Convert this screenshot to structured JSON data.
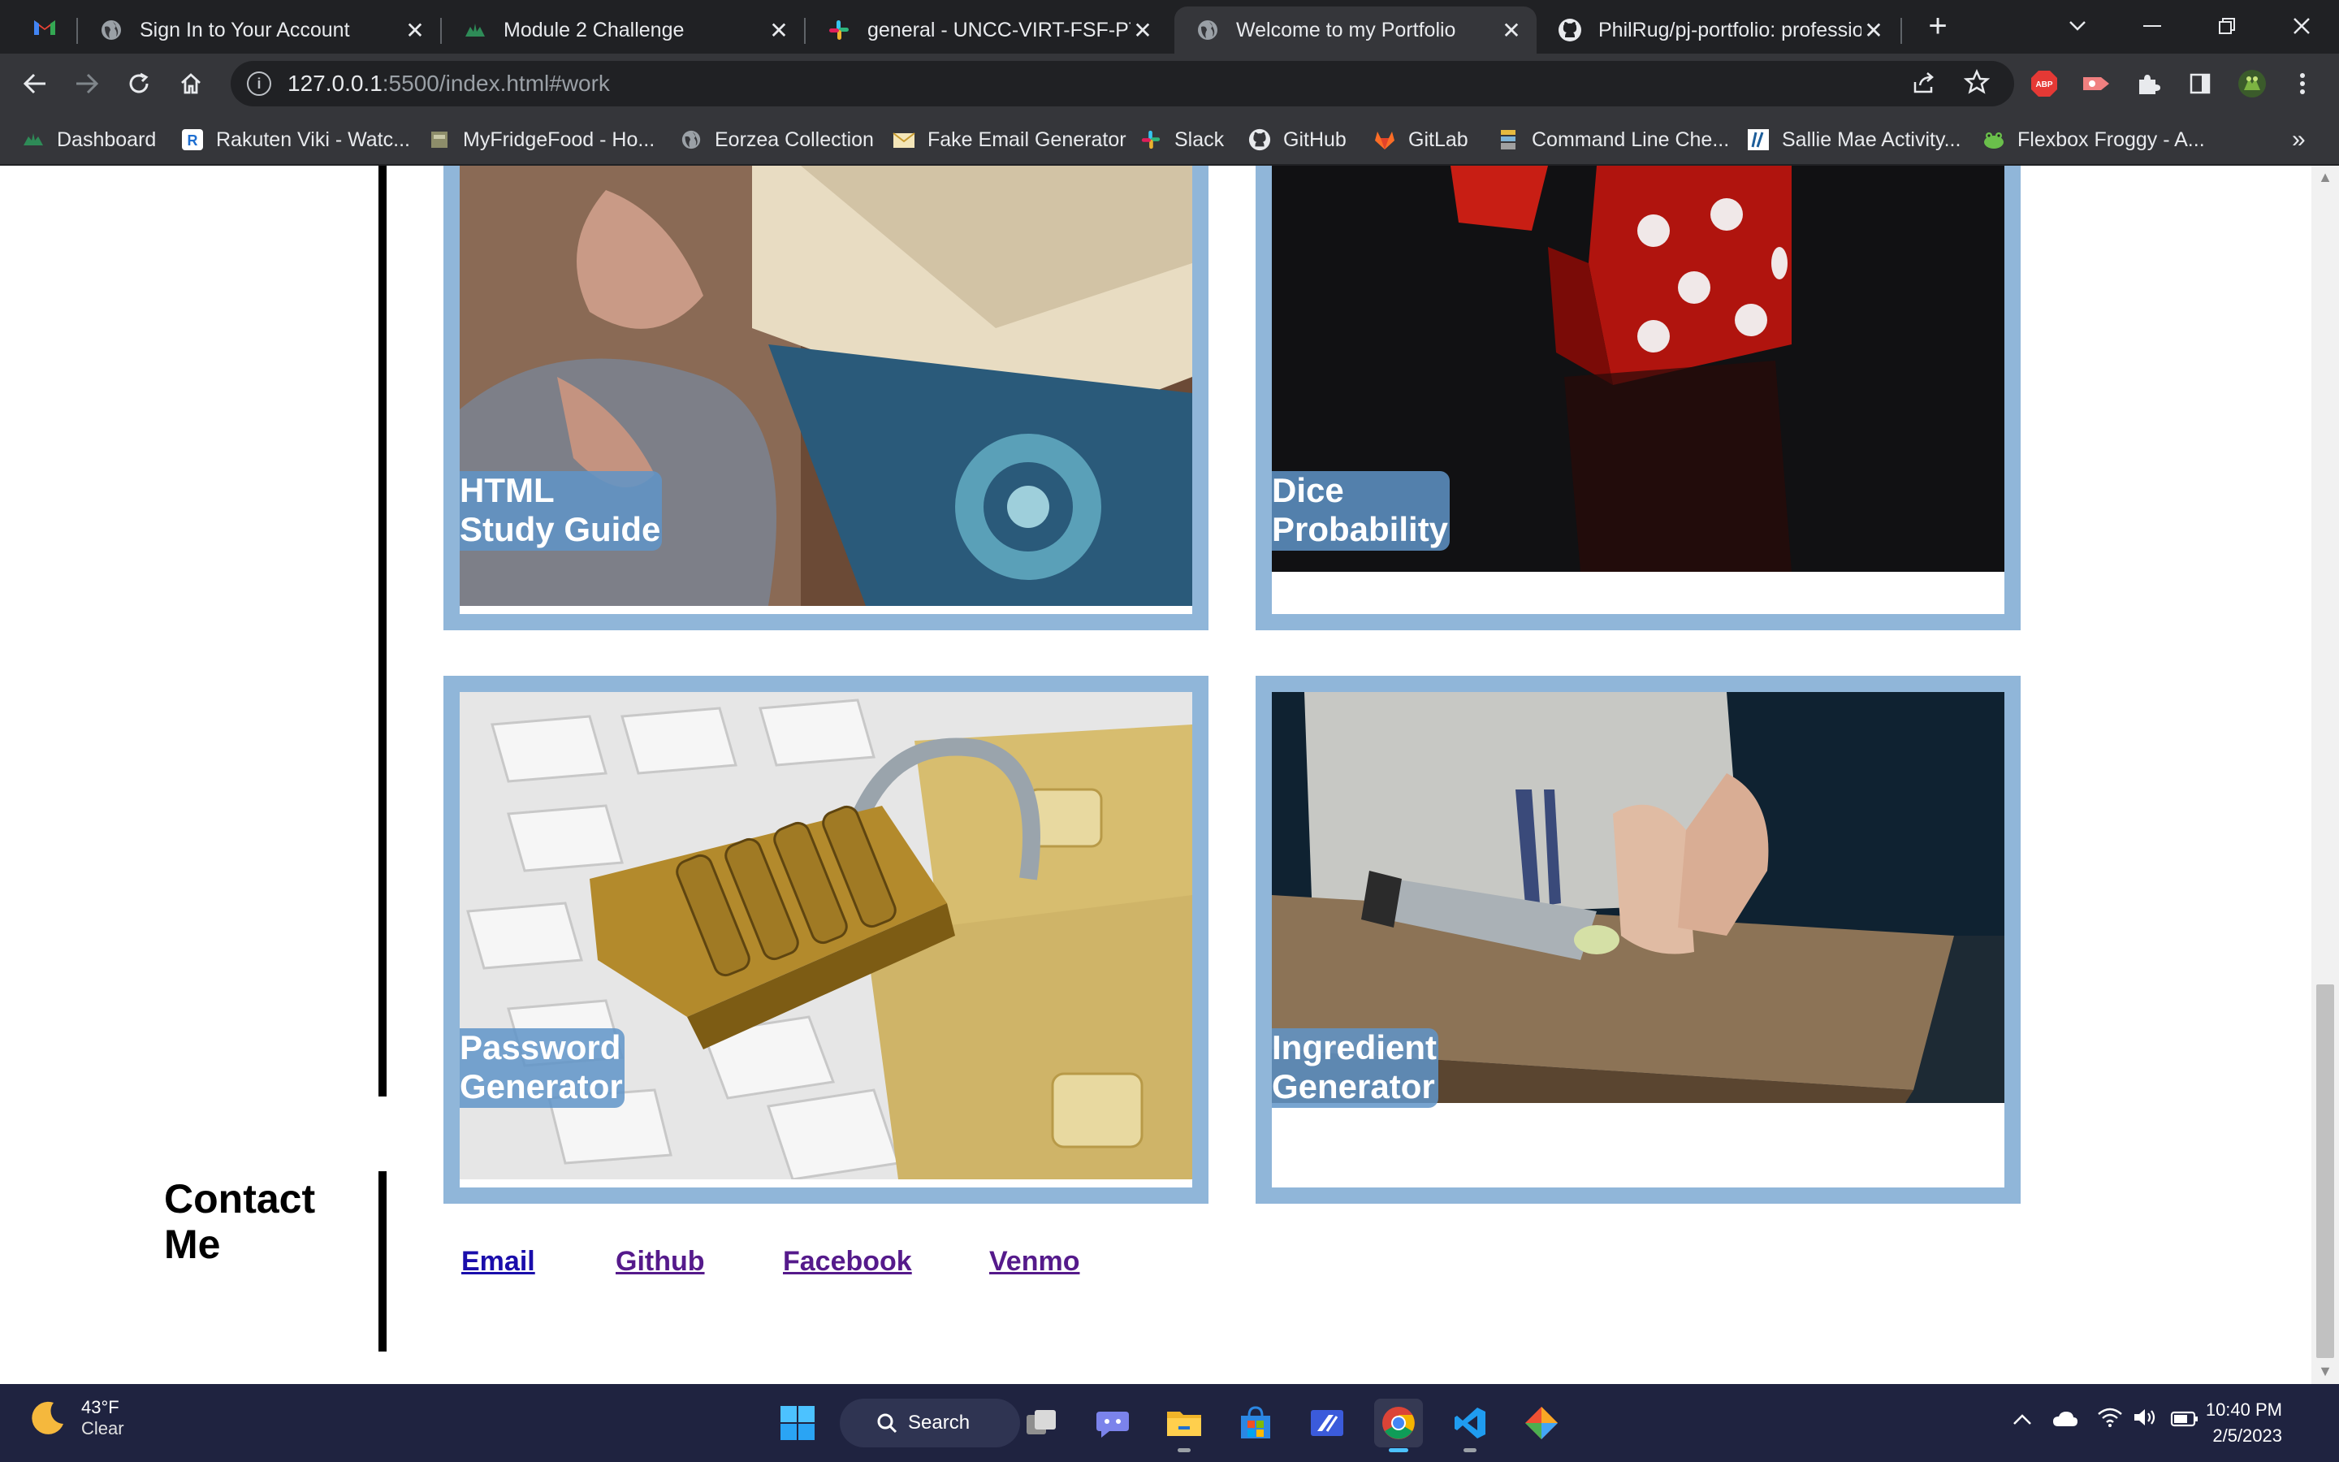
{
  "browser": {
    "tabs": [
      {
        "title": "Sign In to Your Account",
        "icon": "globe-icon",
        "active": false
      },
      {
        "title": "Module 2 Challenge",
        "icon": "frog-icon",
        "active": false
      },
      {
        "title": "general - UNCC-VIRT-FSF-PT-0",
        "icon": "slack-icon",
        "active": false
      },
      {
        "title": "Welcome to my Portfolio",
        "icon": "globe-icon",
        "active": true
      },
      {
        "title": "PhilRug/pj-portfolio: professio",
        "icon": "github-icon",
        "active": false
      }
    ],
    "new_tab_label": "+",
    "url_host": "127.0.0.1",
    "url_rest": ":5500/index.html#work",
    "bookmarks": [
      {
        "label": "Dashboard",
        "icon": "frog-icon"
      },
      {
        "label": "Rakuten Viki - Watc...",
        "icon": "viki-icon"
      },
      {
        "label": "MyFridgeFood - Ho...",
        "icon": "fridge-icon"
      },
      {
        "label": "Eorzea Collection",
        "icon": "globe-icon"
      },
      {
        "label": "Fake Email Generator",
        "icon": "envelope-icon"
      },
      {
        "label": "Slack",
        "icon": "slack-icon"
      },
      {
        "label": "GitHub",
        "icon": "github-icon"
      },
      {
        "label": "GitLab",
        "icon": "gitlab-icon"
      },
      {
        "label": "Command Line Che...",
        "icon": "terminal-icon"
      },
      {
        "label": "Sallie Mae Activity...",
        "icon": "salliemae-icon"
      },
      {
        "label": "Flexbox Froggy - A...",
        "icon": "frog-icon"
      }
    ],
    "bookmarks_overflow": "»",
    "extension_badge": "ABP"
  },
  "portfolio": {
    "projects": [
      {
        "line1": "HTML",
        "line2": "Study Guide",
        "image": "book-photo"
      },
      {
        "line1": "Dice",
        "line2": "Probability",
        "image": "dice-photo"
      },
      {
        "line1": "Password",
        "line2": "Generator",
        "image": "padlock-keyboard-photo"
      },
      {
        "line1": "Ingredient",
        "line2": "Generator",
        "image": "cutting-board-photo"
      }
    ],
    "contact": {
      "title": "Contact Me",
      "links": [
        "Email",
        "Github",
        "Facebook",
        "Venmo"
      ]
    }
  },
  "taskbar": {
    "weather_temp": "43°F",
    "weather_cond": "Clear",
    "search_label": "Search",
    "time": "10:40 PM",
    "date": "2/5/2023"
  },
  "colors": {
    "card_border": "#90b6d9",
    "caption_bg": "#5f94c8",
    "browser_dark": "#202124",
    "browser_toolbar": "#35363a",
    "taskbar": "#1f2340"
  }
}
